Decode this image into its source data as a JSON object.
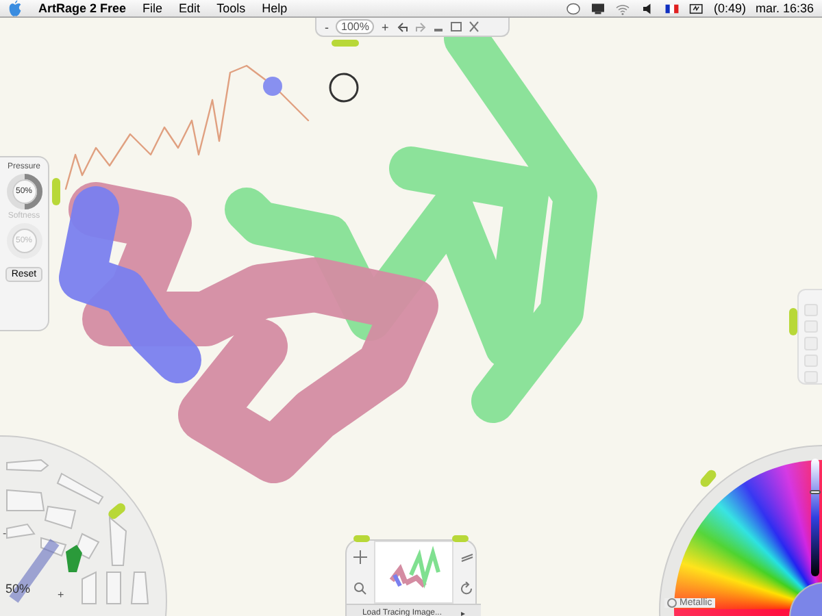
{
  "menu_bar": {
    "app_name": "ArtRage 2 Free",
    "menus": [
      "File",
      "Edit",
      "Tools",
      "Help"
    ],
    "battery": "(0:49)",
    "clock": "mar. 16:36"
  },
  "zoom_bar": {
    "minus": "-",
    "zoom": "100%",
    "plus": "+"
  },
  "settings_panel": {
    "pressure_label": "Pressure",
    "pressure": {
      "value": "50%",
      "level": 0.5
    },
    "softness_label": "Softness",
    "softness": {
      "value": "50%",
      "disabled": true
    },
    "reset": "Reset"
  },
  "tool_picker": {
    "size": "50%",
    "minus": "-",
    "plus": "+"
  },
  "navigator": {
    "load_tracing": "Load Tracing Image...",
    "arrow": "▸"
  },
  "color_picker": {
    "metallic": "Metallic",
    "metallic_checked": false,
    "luminance": {
      "level": 0.72
    }
  }
}
